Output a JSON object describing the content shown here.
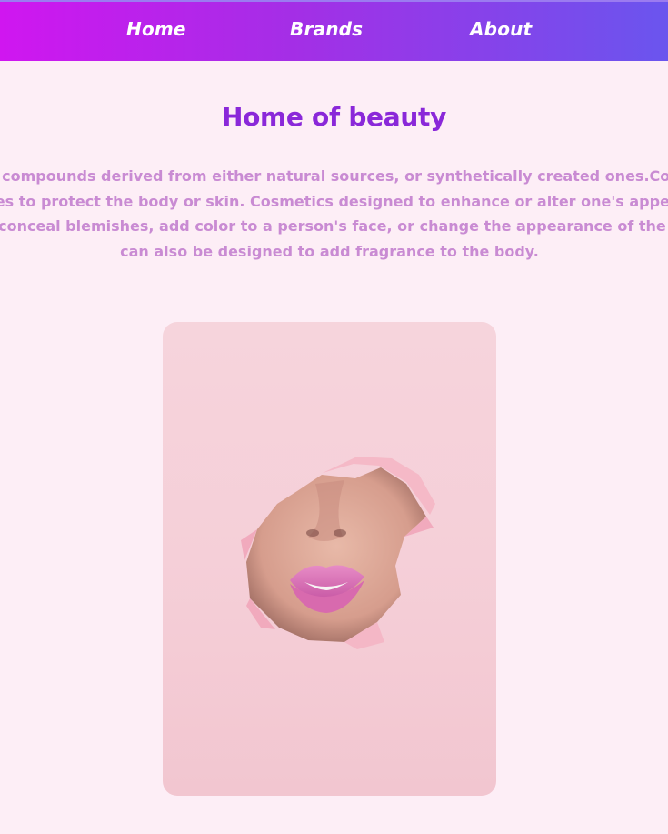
{
  "nav": {
    "home_label": "Home",
    "brands_label": "Brands",
    "about_label": "About"
  },
  "main": {
    "title": "Home of beauty",
    "intro_lines": [
      "Cosmetics are compounds derived from either natural sources, or synthetically created ones.Cosmetics have",
      "various purposes to protect the body or skin. Cosmetics designed to enhance or alter one's appearance makeup",
      "can be used to conceal blemishes, add color to a person's face, or change the appearance of the face entirely to resemble",
      "can also be designed to add fragrance to the body."
    ]
  },
  "colors": {
    "background": "#fdeef6",
    "nav_gradient_start": "#d016f0",
    "nav_gradient_end": "#6a55ee",
    "title": "#8a28d9",
    "body_text": "#c98bd3",
    "photo_background": "#f5cfd8",
    "lips": "#e07ab8"
  },
  "image": {
    "subject": "lips peeking through torn pink paper"
  }
}
